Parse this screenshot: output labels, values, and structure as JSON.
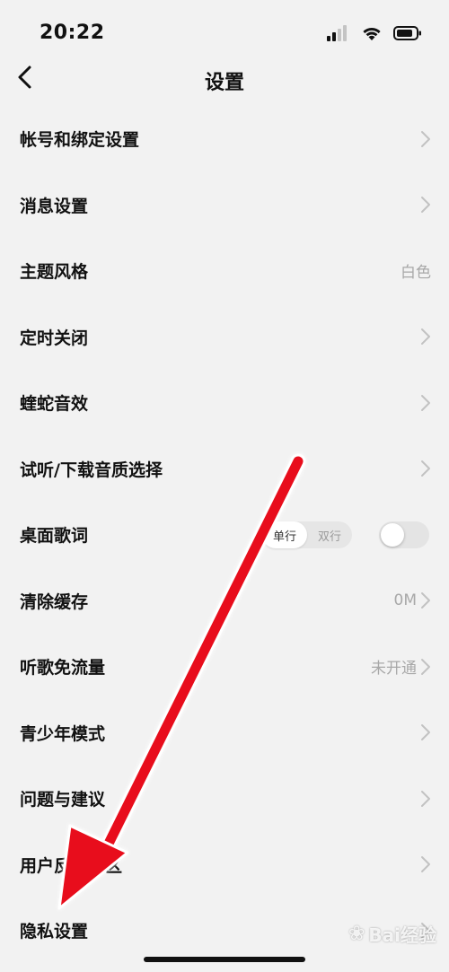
{
  "status_bar": {
    "time": "20:22",
    "icons": [
      "signal-icon",
      "wifi-icon",
      "battery-icon"
    ]
  },
  "nav": {
    "title": "设置",
    "back_icon": "chevron-left-icon"
  },
  "settings": {
    "account": {
      "label": "帐号和绑定设置"
    },
    "message": {
      "label": "消息设置"
    },
    "theme": {
      "label": "主题风格",
      "value": "白色"
    },
    "timer": {
      "label": "定时关闭"
    },
    "sound": {
      "label": "蝰蛇音效"
    },
    "quality": {
      "label": "试听/下载音质选择"
    },
    "lyrics": {
      "label": "桌面歌词",
      "segment_options": [
        "单行",
        "双行"
      ],
      "selected_option": "单行",
      "toggle_on": false
    },
    "cache": {
      "label": "清除缓存",
      "value": "0M"
    },
    "free_data": {
      "label": "听歌免流量",
      "value": "未开通"
    },
    "teen": {
      "label": "青少年模式"
    },
    "feedback": {
      "label": "问题与建议"
    },
    "community": {
      "label": "用户反馈社区"
    },
    "privacy": {
      "label": "隐私设置"
    }
  },
  "watermark": {
    "text": "Bai经验"
  },
  "colors": {
    "background": "#f2f2f2",
    "text": "#111111",
    "secondary": "#a8a8a8",
    "annotation_arrow": "#e8101a"
  }
}
